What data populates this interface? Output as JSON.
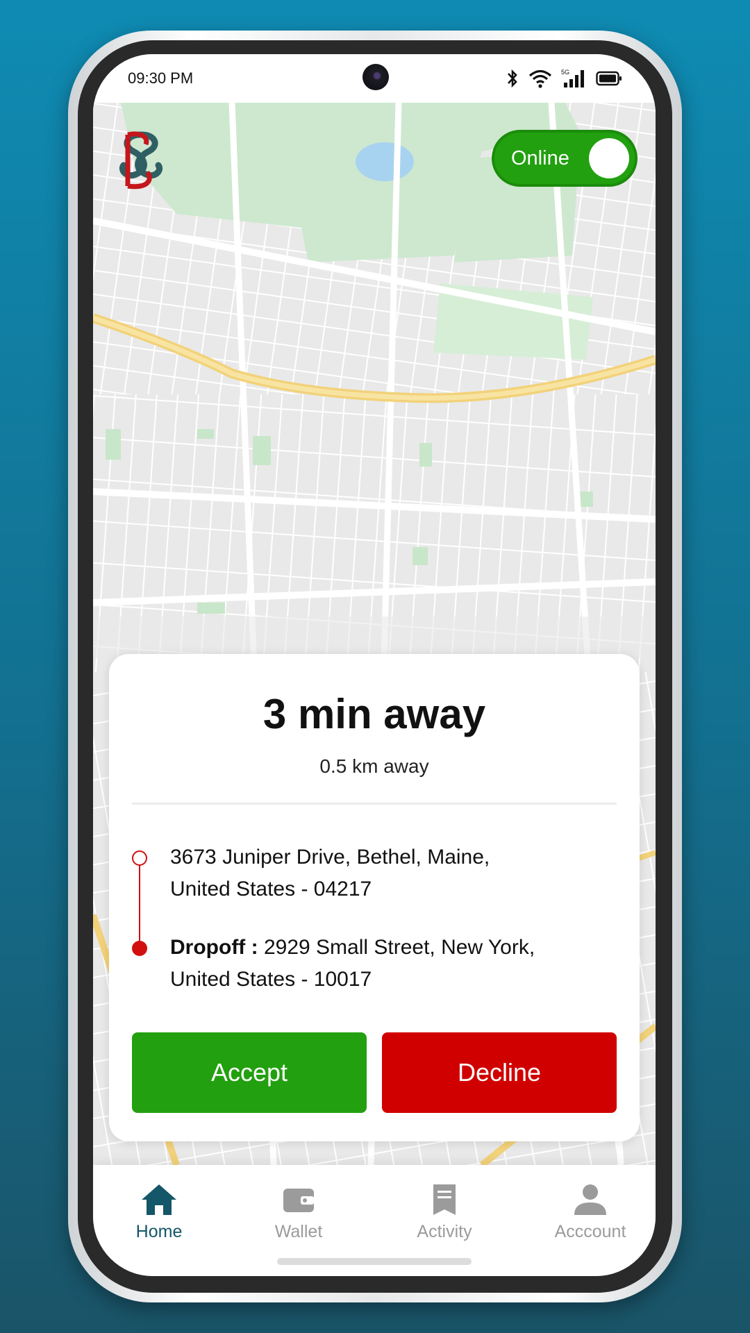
{
  "status_bar": {
    "time": "09:30 PM",
    "network": "5G"
  },
  "header": {
    "online_label": "Online",
    "online_state": true
  },
  "ride_request": {
    "eta": "3 min away",
    "distance": "0.5 km away",
    "pickup_line1": "3673 Juniper Drive, Bethel, Maine,",
    "pickup_line2": "United States - 04217",
    "dropoff_prefix": "Dropoff :",
    "dropoff_line1": " 2929 Small Street, New York,",
    "dropoff_line2": "United States - 10017",
    "accept_label": "Accept",
    "decline_label": "Decline"
  },
  "bottom_nav": {
    "items": [
      {
        "label": "Home",
        "icon": "home-icon",
        "active": true
      },
      {
        "label": "Wallet",
        "icon": "wallet-icon",
        "active": false
      },
      {
        "label": "Activity",
        "icon": "receipt-icon",
        "active": false
      },
      {
        "label": "Acccount",
        "icon": "user-icon",
        "active": false
      }
    ]
  },
  "colors": {
    "accent_green": "#22a00f",
    "decline_red": "#d10000",
    "nav_active": "#135768",
    "nav_inactive": "#9b9b9b",
    "route_red": "#d10f0f"
  }
}
